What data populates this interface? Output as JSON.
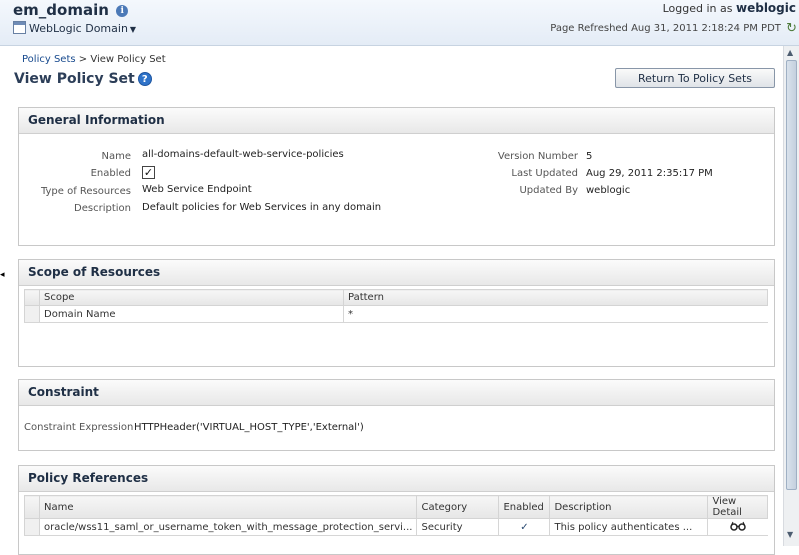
{
  "header": {
    "domain_name": "em_domain",
    "info_icon": "i",
    "domain_menu": "WebLogic Domain",
    "logged_in_label": "Logged in as",
    "username": "weblogic",
    "page_refreshed": "Page Refreshed Aug 31, 2011 2:18:24 PM PDT"
  },
  "breadcrumb": {
    "link": "Policy Sets",
    "separator": ">",
    "current": "View Policy Set"
  },
  "page": {
    "title": "View Policy Set",
    "help_icon": "?",
    "return_button": "Return To Policy Sets"
  },
  "general": {
    "title": "General Information",
    "name_label": "Name",
    "name_value": "all-domains-default-web-service-policies",
    "enabled_label": "Enabled",
    "enabled_checked": true,
    "resources_label": "Type of Resources",
    "resources_value": "Web Service Endpoint",
    "description_label": "Description",
    "description_value": "Default policies for Web Services in any domain",
    "version_label": "Version Number",
    "version_value": "5",
    "updated_label": "Last Updated",
    "updated_value": "Aug 29, 2011 2:35:17 PM",
    "updated_by_label": "Updated By",
    "updated_by_value": "weblogic"
  },
  "scope": {
    "title": "Scope of Resources",
    "columns": [
      "Scope",
      "Pattern"
    ],
    "rows": [
      {
        "scope": "Domain Name",
        "pattern": "*"
      }
    ]
  },
  "constraint": {
    "title": "Constraint",
    "label": "Constraint Expression",
    "value": "HTTPHeader('VIRTUAL_HOST_TYPE','External')"
  },
  "policies": {
    "title": "Policy References",
    "columns": [
      "Name",
      "Category",
      "Enabled",
      "Description",
      "View Detail"
    ],
    "rows": [
      {
        "name": "oracle/wss11_saml_or_username_token_with_message_protection_servi...",
        "category": "Security",
        "enabled": "✓",
        "description": "This policy authenticates ...",
        "view_icon": "glasses-icon"
      }
    ]
  }
}
